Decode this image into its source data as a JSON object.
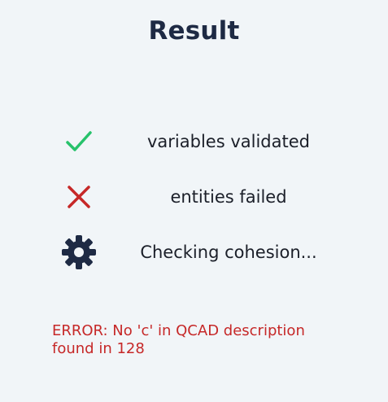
{
  "page": {
    "title": "Result"
  },
  "status": {
    "items": [
      {
        "label": "variables validated",
        "icon": "check-icon",
        "color": "#27c26b"
      },
      {
        "label": "entities failed",
        "icon": "x-icon",
        "color": "#c62828"
      },
      {
        "label": "Checking cohesion...",
        "icon": "gear-icon",
        "color": "#1e2a44"
      }
    ]
  },
  "error": {
    "message": "ERROR: No 'c' in QCAD description found in 128",
    "color": "#c62828"
  }
}
